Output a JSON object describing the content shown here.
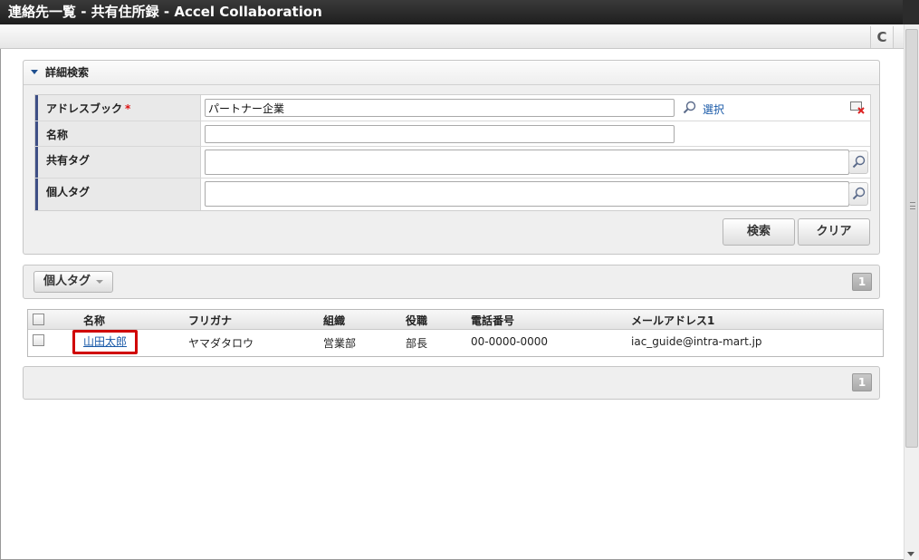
{
  "window": {
    "title": "連絡先一覧 - 共有住所録 - Accel Collaboration"
  },
  "toolbar": {
    "refresh_icon": "refresh-icon",
    "refresh_glyph": "C"
  },
  "search_panel": {
    "title": "詳細検索",
    "fields": {
      "address_book": {
        "label": "アドレスブック",
        "required_mark": "*",
        "value": "パートナー企業",
        "select_link": "選択"
      },
      "name": {
        "label": "名称",
        "value": ""
      },
      "shared_tag": {
        "label": "共有タグ",
        "value": ""
      },
      "personal_tag": {
        "label": "個人タグ",
        "value": ""
      }
    },
    "buttons": {
      "search": "検索",
      "clear": "クリア"
    }
  },
  "tag_bar": {
    "dropdown_label": "個人タグ",
    "page": "1"
  },
  "results": {
    "columns": {
      "name": "名称",
      "furigana": "フリガナ",
      "organization": "組織",
      "position": "役職",
      "phone": "電話番号",
      "email": "メールアドレス1"
    },
    "rows": [
      {
        "name": "山田太郎",
        "furigana": "ヤマダタロウ",
        "organization": "営業部",
        "position": "部長",
        "phone": "00-0000-0000",
        "email": "iac_guide@intra-mart.jp"
      }
    ],
    "highlight_color": "#d00000"
  },
  "footer": {
    "page": "1"
  },
  "colors": {
    "accent": "#3e4f86",
    "link": "#1a5aa8",
    "titlebar": "#2a2a2a"
  }
}
